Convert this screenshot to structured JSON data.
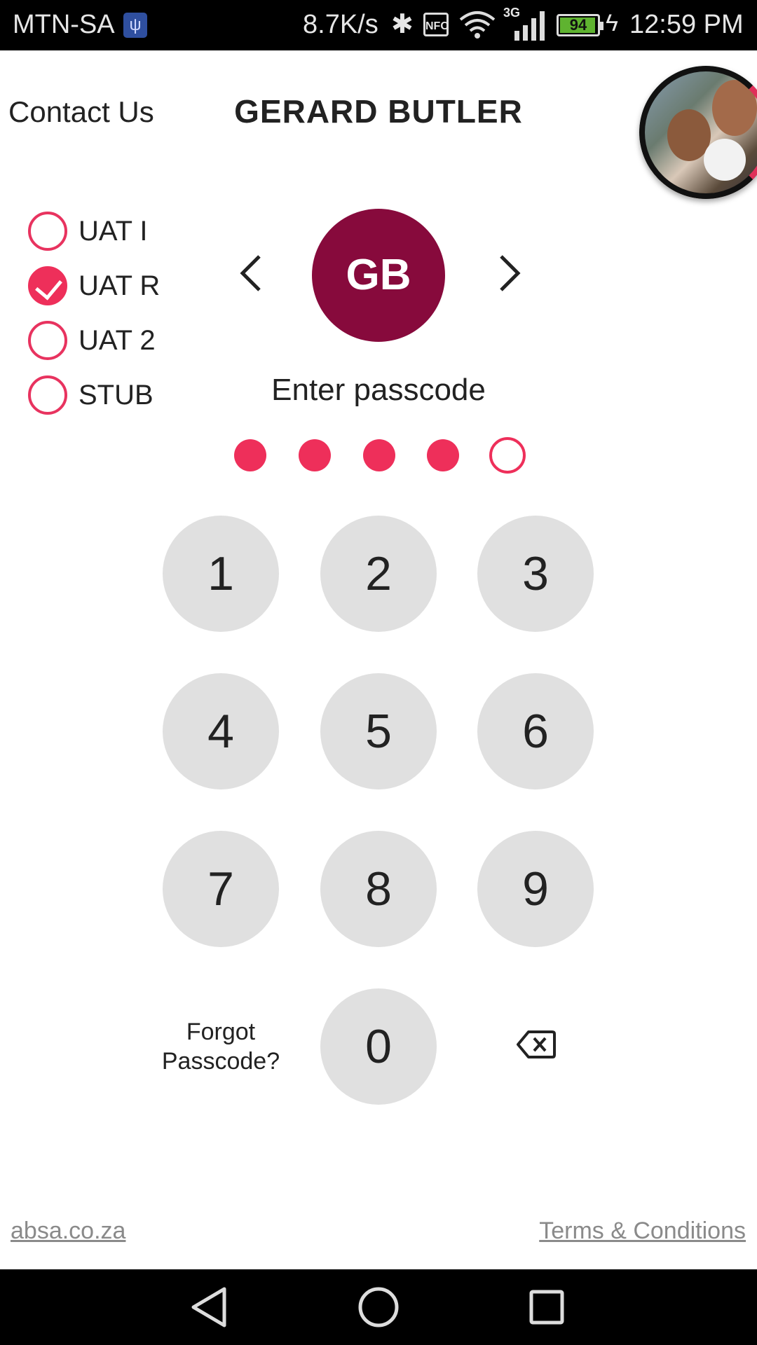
{
  "status_bar": {
    "carrier": "MTN-SA",
    "network_speed": "8.7K/s",
    "network_type": "3G",
    "battery_level": "94",
    "time": "12:59 PM"
  },
  "header": {
    "contact_link": "Contact Us",
    "user_name": "GERARD BUTLER"
  },
  "environments": [
    {
      "label": "UAT I",
      "selected": false
    },
    {
      "label": "UAT R",
      "selected": true
    },
    {
      "label": "UAT 2",
      "selected": false
    },
    {
      "label": "STUB",
      "selected": false
    }
  ],
  "profile": {
    "initials": "GB"
  },
  "passcode": {
    "prompt": "Enter passcode",
    "length": 5,
    "entered": 4
  },
  "keypad": {
    "keys": [
      "1",
      "2",
      "3",
      "4",
      "5",
      "6",
      "7",
      "8",
      "9",
      "0"
    ],
    "forgot_line1": "Forgot",
    "forgot_line2": "Passcode?"
  },
  "footer": {
    "site_link": "absa.co.za",
    "terms_link": "Terms & Conditions"
  },
  "colors": {
    "accent": "#ee2f5a",
    "avatar_bg": "#870a3c",
    "key_bg": "#e0e0e0"
  },
  "icons": [
    "usb-icon",
    "bluetooth-icon",
    "nfc-icon",
    "wifi-icon",
    "signal-icon",
    "battery-icon",
    "charging-icon",
    "chevron-left-icon",
    "chevron-right-icon",
    "backspace-icon",
    "back-icon",
    "home-icon",
    "recents-icon"
  ]
}
